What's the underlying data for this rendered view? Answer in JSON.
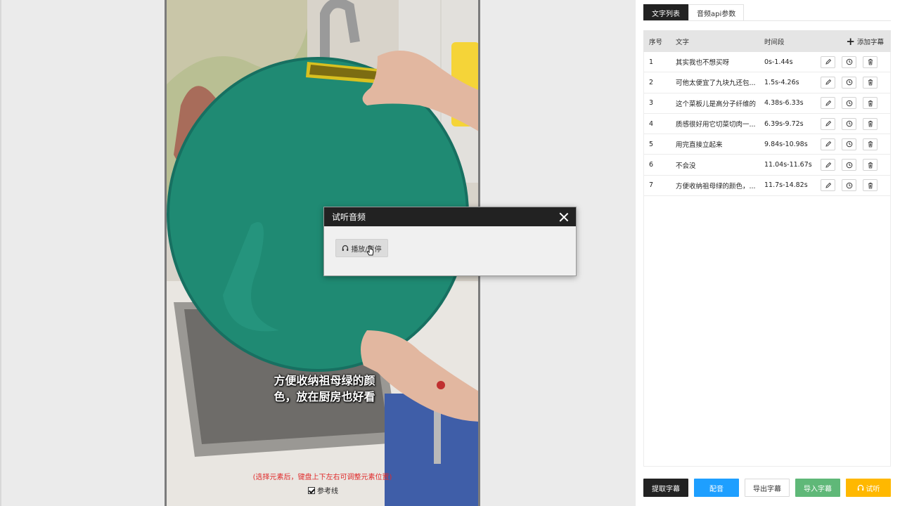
{
  "video": {
    "subtitle_line1": "方便收纳祖母绿的颜",
    "subtitle_line2": "色，放在厨房也好看",
    "hint": "(选择元素后，键盘上下左右可调整元素位置)",
    "refline_label": "参考线",
    "refline_checked": true
  },
  "dialog": {
    "title": "试听音频",
    "play_label": "播放/暂停",
    "play_icon": "headphones-icon",
    "close_icon": "close-icon"
  },
  "panel": {
    "tabs": [
      {
        "label": "文字列表",
        "active": true
      },
      {
        "label": "音频api参数",
        "active": false
      }
    ],
    "table": {
      "headers": {
        "index": "序号",
        "text": "文字",
        "time": "时间段",
        "add": "添加字幕"
      },
      "rows": [
        {
          "index": "1",
          "text": "其实我也不想买呀",
          "time": "0s-1.44s"
        },
        {
          "index": "2",
          "text": "可他太便宜了九块九还包...",
          "time": "1.5s-4.26s"
        },
        {
          "index": "3",
          "text": "这个菜板儿是高分子纤维的",
          "time": "4.38s-6.33s"
        },
        {
          "index": "4",
          "text": "质感很好用它切菜切肉一...",
          "time": "6.39s-9.72s"
        },
        {
          "index": "5",
          "text": "用完直接立起来",
          "time": "9.84s-10.98s"
        },
        {
          "index": "6",
          "text": "不会没",
          "time": "11.04s-11.67s"
        },
        {
          "index": "7",
          "text": "方便收纳祖母绿的颜色，...",
          "time": "11.7s-14.82s"
        }
      ],
      "row_actions": [
        "edit-icon",
        "clock-icon",
        "trash-icon"
      ]
    },
    "footer": {
      "extract": "提取字幕",
      "dub": "配音",
      "export": "导出字幕",
      "import": "导入字幕",
      "listen": "试听"
    }
  },
  "colors": {
    "dark": "#222222",
    "blue": "#1e9fff",
    "green": "#5fb878",
    "orange": "#ffb800",
    "hint_red": "#e02b2b"
  }
}
